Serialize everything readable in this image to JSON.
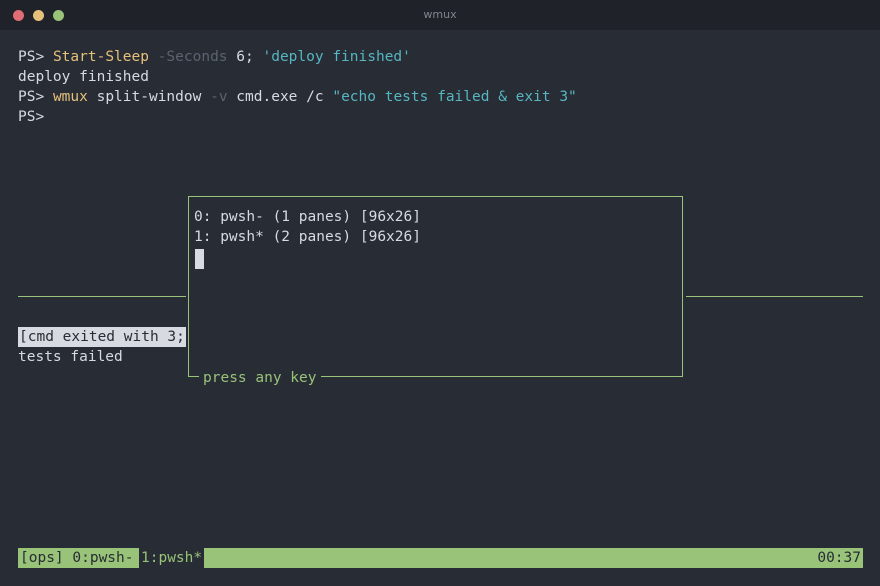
{
  "window": {
    "title": "wmux",
    "accent_color": "#98c379",
    "background_color": "#282c34"
  },
  "terminal": {
    "prompt": "PS>",
    "lines": [
      {
        "command": "Start-Sleep",
        "flag": "-Seconds",
        "number": "6;",
        "string": "'deploy finished'"
      },
      {
        "output": "deploy finished"
      },
      {
        "command": "wmux",
        "args": "split-window",
        "flag": "-v",
        "rest": "cmd.exe /c",
        "string": "\"echo tests failed & exit 3\""
      }
    ],
    "last_prompt": "PS>"
  },
  "lower_pane": {
    "exit_message": "[cmd exited with 3;",
    "output": "tests failed"
  },
  "popup": {
    "windows": [
      "0: pwsh- (1 panes) [96x26]",
      "1: pwsh* (2 panes) [96x26]"
    ],
    "footer": "press any key"
  },
  "statusbar": {
    "session": "[ops] 0:pwsh-",
    "active_window": "1:pwsh*",
    "clock": "00:37"
  }
}
